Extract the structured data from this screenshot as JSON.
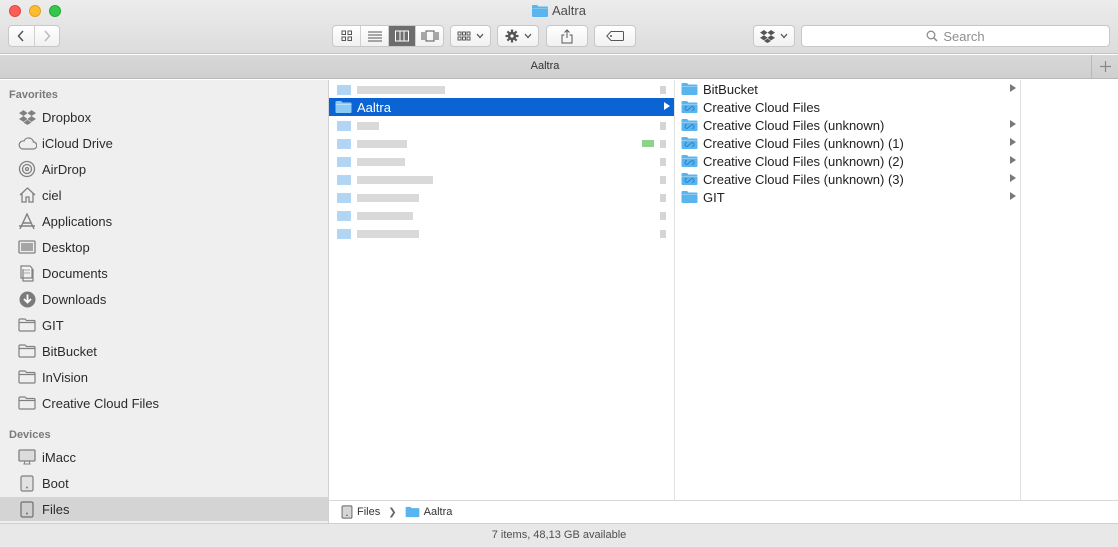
{
  "window": {
    "title": "Aaltra"
  },
  "toolbar": {
    "search_placeholder": "Search",
    "view_modes": [
      "icons",
      "list",
      "columns",
      "cover-flow"
    ],
    "active_view": "columns"
  },
  "tab": {
    "label": "Aaltra"
  },
  "sidebar": {
    "favorites_heading": "Favorites",
    "favorites": [
      {
        "label": "Dropbox",
        "icon": "dropbox-icon"
      },
      {
        "label": "iCloud Drive",
        "icon": "cloud-icon"
      },
      {
        "label": "AirDrop",
        "icon": "airdrop-icon"
      },
      {
        "label": "ciel",
        "icon": "home-icon"
      },
      {
        "label": "Applications",
        "icon": "applications-icon"
      },
      {
        "label": "Desktop",
        "icon": "desktop-icon"
      },
      {
        "label": "Documents",
        "icon": "documents-icon"
      },
      {
        "label": "Downloads",
        "icon": "downloads-icon"
      },
      {
        "label": "GIT",
        "icon": "folder-icon"
      },
      {
        "label": "BitBucket",
        "icon": "folder-icon"
      },
      {
        "label": "InVision",
        "icon": "folder-icon"
      },
      {
        "label": "Creative Cloud Files",
        "icon": "folder-icon"
      }
    ],
    "devices_heading": "Devices",
    "devices": [
      {
        "label": "iMacc",
        "icon": "imac-icon"
      },
      {
        "label": "Boot",
        "icon": "disk-icon"
      },
      {
        "label": "Files",
        "icon": "disk-icon",
        "selected": true
      }
    ]
  },
  "column1": {
    "selected_item": "Aaltra"
  },
  "column2": {
    "items": [
      {
        "label": "BitBucket",
        "icon": "folder-icon"
      },
      {
        "label": "Creative Cloud Files",
        "icon": "creative-cloud-folder-icon"
      },
      {
        "label": "Creative Cloud Files (unknown)",
        "icon": "creative-cloud-folder-icon"
      },
      {
        "label": "Creative Cloud Files (unknown) (1)",
        "icon": "creative-cloud-folder-icon"
      },
      {
        "label": "Creative Cloud Files (unknown) (2)",
        "icon": "creative-cloud-folder-icon"
      },
      {
        "label": "Creative Cloud Files (unknown) (3)",
        "icon": "creative-cloud-folder-icon"
      },
      {
        "label": "GIT",
        "icon": "folder-icon"
      }
    ]
  },
  "pathbar": {
    "segments": [
      "Files",
      "Aaltra"
    ]
  },
  "status": {
    "text": "7 items, 48,13 GB available"
  },
  "colors": {
    "selection": "#0b64d3",
    "folder": "#5ab5ef"
  }
}
